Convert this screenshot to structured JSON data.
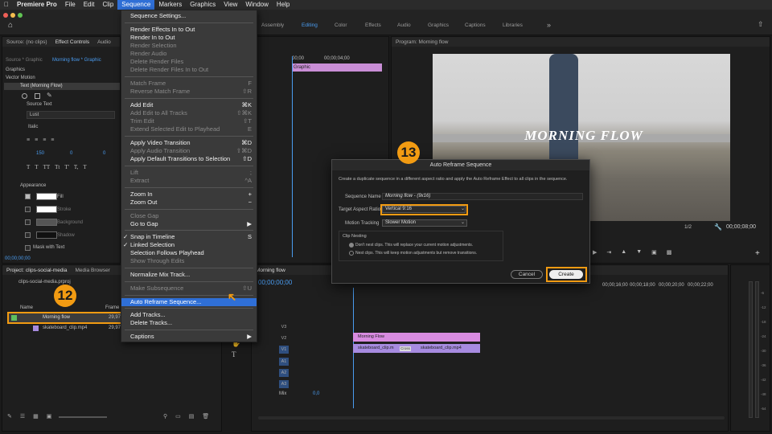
{
  "menubar": {
    "app": "Premiere Pro",
    "items": [
      "File",
      "Edit",
      "Clip",
      "Sequence",
      "Markers",
      "Graphics",
      "View",
      "Window",
      "Help"
    ]
  },
  "workspace_tabs": [
    "Assembly",
    "Editing",
    "Color",
    "Effects",
    "Audio",
    "Graphics",
    "Captions",
    "Libraries"
  ],
  "source_panel": {
    "tab_source": "Source: (no clips)",
    "tab_effect_controls": "Effect Controls",
    "tab_audio": "Audio",
    "crumb_source": "Source * Graphic",
    "crumb_seq": "Morning flow * Graphic",
    "section_graphic": "Graphics",
    "vector_motion": "Vector Motion",
    "text_layer": "Text (Morning Flow)",
    "source_text": "Source Text",
    "font": "Lust",
    "style": "Italic",
    "size": "150",
    "tracking": "0",
    "kerning": "0",
    "appearance": "Appearance",
    "fill": "Fill",
    "stroke": "Stroke",
    "background": "Background",
    "shadow": "Shadow",
    "mask_with_text": "Mask with Text",
    "timecode": "00;00;00;00"
  },
  "sequence_menu": {
    "items": [
      {
        "label": "Sequence Settings...",
        "shortcut": "",
        "disabled": false
      },
      {
        "label": "Render Effects In to Out",
        "shortcut": "",
        "disabled": false
      },
      {
        "label": "Render In to Out",
        "shortcut": "",
        "disabled": false
      },
      {
        "label": "Render Selection",
        "shortcut": "",
        "disabled": true
      },
      {
        "label": "Render Audio",
        "shortcut": "",
        "disabled": true
      },
      {
        "label": "Delete Render Files",
        "shortcut": "",
        "disabled": true
      },
      {
        "label": "Delete Render Files In to Out",
        "shortcut": "",
        "disabled": true
      },
      {
        "label": "Match Frame",
        "shortcut": "F",
        "disabled": true
      },
      {
        "label": "Reverse Match Frame",
        "shortcut": "⇧R",
        "disabled": true
      },
      {
        "label": "Add Edit",
        "shortcut": "⌘K",
        "disabled": false
      },
      {
        "label": "Add Edit to All Tracks",
        "shortcut": "⇧⌘K",
        "disabled": true
      },
      {
        "label": "Trim Edit",
        "shortcut": "⇧T",
        "disabled": true
      },
      {
        "label": "Extend Selected Edit to Playhead",
        "shortcut": "E",
        "disabled": true
      },
      {
        "label": "Apply Video Transition",
        "shortcut": "⌘D",
        "disabled": false
      },
      {
        "label": "Apply Audio Transition",
        "shortcut": "⇧⌘D",
        "disabled": true
      },
      {
        "label": "Apply Default Transitions to Selection",
        "shortcut": "⇧D",
        "disabled": false
      },
      {
        "label": "Lift",
        "shortcut": ";",
        "disabled": true
      },
      {
        "label": "Extract",
        "shortcut": "^A",
        "disabled": true
      },
      {
        "label": "Zoom In",
        "shortcut": "+",
        "disabled": false
      },
      {
        "label": "Zoom Out",
        "shortcut": "−",
        "disabled": false
      },
      {
        "label": "Close Gap",
        "shortcut": "",
        "disabled": true
      },
      {
        "label": "Go to Gap",
        "shortcut": "▶",
        "disabled": false
      },
      {
        "label": "Snap in Timeline",
        "shortcut": "S",
        "disabled": false,
        "checked": true
      },
      {
        "label": "Linked Selection",
        "shortcut": "",
        "disabled": false,
        "checked": true
      },
      {
        "label": "Selection Follows Playhead",
        "shortcut": "",
        "disabled": false
      },
      {
        "label": "Show Through Edits",
        "shortcut": "",
        "disabled": true
      },
      {
        "label": "Normalize Mix Track...",
        "shortcut": "",
        "disabled": false
      },
      {
        "label": "Make Subsequence",
        "shortcut": "⇧U",
        "disabled": true
      },
      {
        "label": "Auto Reframe Sequence...",
        "shortcut": "",
        "disabled": false,
        "highlighted": true
      },
      {
        "label": "Add Tracks...",
        "shortcut": "",
        "disabled": false
      },
      {
        "label": "Delete Tracks...",
        "shortcut": "",
        "disabled": false
      },
      {
        "label": "Captions",
        "shortcut": "▶",
        "disabled": false
      }
    ]
  },
  "program_monitor": {
    "title": "Program: Morning flow",
    "overlay_text": "MORNING FLOW",
    "zoom": "1/2",
    "timecode": "00;00;08;00"
  },
  "timeline_top": {
    "tc_start": "00;00",
    "tc_mid": "00;00;04;00",
    "clip_label": "Graphic"
  },
  "dialog": {
    "title": "Auto Reframe Sequence",
    "description": "Create a duplicate sequence in a different aspect ratio and apply the Auto Reframe Effect to all clips in the sequence.",
    "sequence_name_label": "Sequence Name",
    "sequence_name_value": "Morning flow - (9x16)",
    "aspect_label": "Target Aspect Ratio",
    "aspect_value": "Vertical 9:16",
    "tracking_label": "Motion Tracking",
    "tracking_value": "Slower Motion",
    "nesting_label": "Clip Nesting",
    "opt_dont_nest": "Don't nest clips. This will replace your current motion adjustments.",
    "opt_nest": "Nest clips. This will keep motion adjustments but remove transitions.",
    "cancel": "Cancel",
    "create": "Create"
  },
  "callouts": {
    "step12": "12",
    "step13": "13"
  },
  "project_panel": {
    "tab_project": "Project: clips-social-media",
    "tab_media": "Media Browser",
    "file": "clips-social-media.prproj",
    "col_name": "Name",
    "col_frame": "Frame",
    "items": [
      {
        "name": "Morning flow",
        "rate": "29,97"
      },
      {
        "name": "skateboard_clip.mp4",
        "rate": "29,97 f"
      }
    ]
  },
  "timeline": {
    "tab": "Morning flow",
    "timecode": "00;00;00;00",
    "ruler": [
      "00;00;16;00",
      "00;00;18;00",
      "00;00;20;00",
      "00;00;22;00"
    ],
    "tracks_video": [
      "V3",
      "V2",
      "V1"
    ],
    "tracks_audio": [
      "A1",
      "A2",
      "A3"
    ],
    "mix_label": "Mix",
    "mix_value": "0,0",
    "clip_graphic": "Morning Flow",
    "clip_video1": "skateboard_clip.m",
    "clip_video2": "skateboard_clip.mp4",
    "clip_cross": "Cross"
  },
  "meter": {
    "ticks": [
      "-6",
      "-12",
      "-18",
      "-24",
      "-30",
      "-36",
      "-42",
      "-48",
      "-54",
      "dB"
    ]
  },
  "colors": {
    "accent": "#2f6fd6",
    "callout": "#f29b12",
    "graphic_clip": "#d88be0",
    "video_clip": "#a78be0"
  }
}
